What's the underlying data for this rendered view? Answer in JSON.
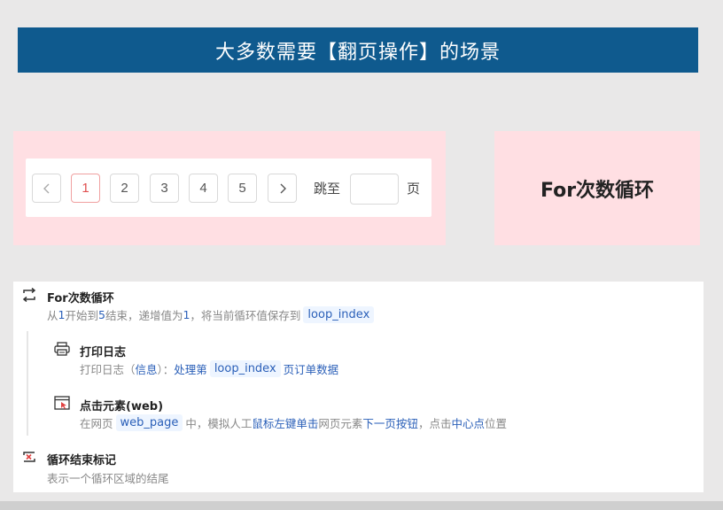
{
  "banner": {
    "title": "大多数需要【翻页操作】的场景"
  },
  "pagination": {
    "pages": [
      "1",
      "2",
      "3",
      "4",
      "5"
    ],
    "active_page": "1",
    "jump_label": "跳至",
    "page_suffix": "页"
  },
  "for_box": {
    "label": "For次数循环"
  },
  "panel": {
    "loop": {
      "title": "For次数循环",
      "desc": {
        "p1": "从",
        "start": "1",
        "p2": "开始到",
        "end": "5",
        "p3": "结束，递增值为",
        "step": "1",
        "p4": "，将当前循环值保存到",
        "var": "loop_index"
      }
    },
    "print_log": {
      "title": "打印日志",
      "desc": {
        "p1": "打印日志（",
        "level": "信息",
        "p2": "）：",
        "p3": "处理第",
        "var": "loop_index",
        "p4": "页订单数据"
      }
    },
    "click_element": {
      "title": "点击元素(web)",
      "desc": {
        "p1": "在网页",
        "var": "web_page",
        "p2": "中，模拟人工",
        "action": "鼠标左键单击",
        "p3": "网页元素",
        "target": "下一页按钮",
        "p4": "，点击",
        "pos": "中心点",
        "p5": "位置"
      }
    },
    "loop_end": {
      "title": "循环结束标记",
      "desc": "表示一个循环区域的结尾"
    }
  },
  "colors": {
    "banner_bg": "#0f5a8e",
    "pink_bg": "#ffdfe3",
    "accent_blue": "#2a5fb8",
    "active_page_red": "#e05050"
  }
}
